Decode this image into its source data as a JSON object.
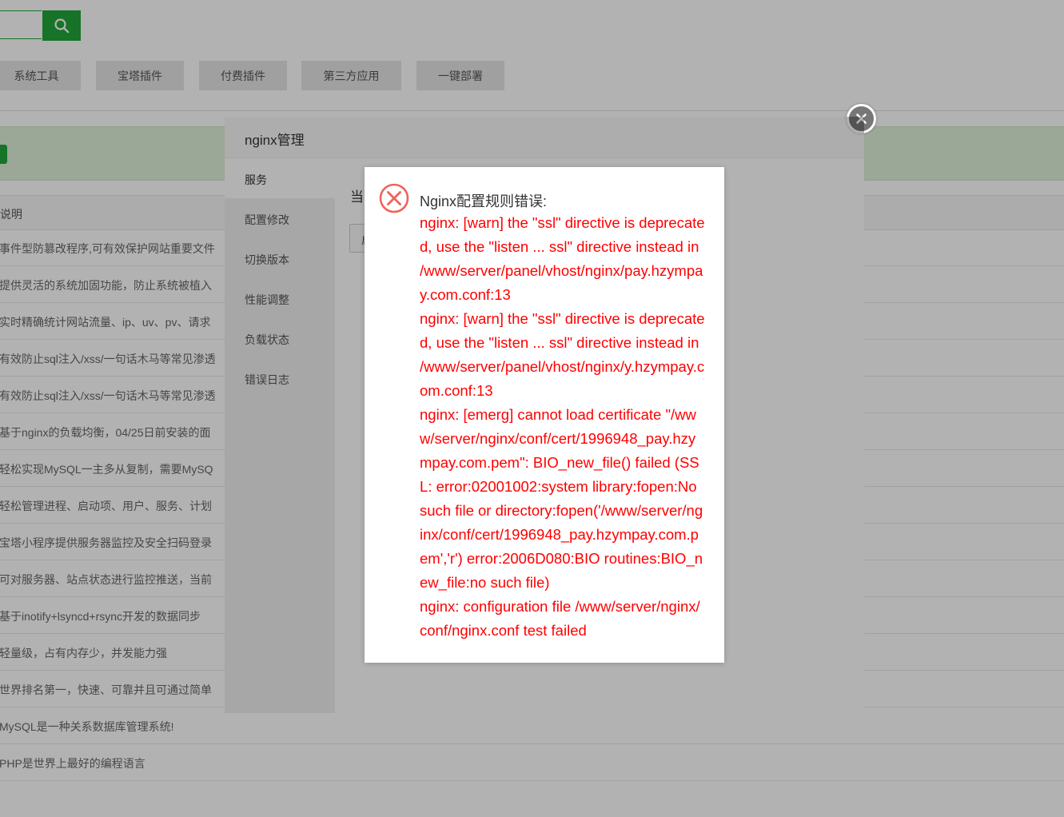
{
  "tabs": [
    "系统工具",
    "宝塔插件",
    "付费插件",
    "第三方应用",
    "一键部署"
  ],
  "table": {
    "header": "说明",
    "rows": [
      "事件型防篡改程序,可有效保护网站重要文件",
      "提供灵活的系统加固功能，防止系统被植入",
      "实时精确统计网站流量、ip、uv、pv、请求",
      "有效防止sql注入/xss/一句话木马等常见渗透",
      "有效防止sql注入/xss/一句话木马等常见渗透",
      "基于nginx的负载均衡，04/25日前安装的面",
      "轻松实现MySQL一主多从复制，需要MySQ",
      "轻松管理进程、启动项、用户、服务、计划",
      "宝塔小程序提供服务器监控及安全扫码登录",
      "可对服务器、站点状态进行监控推送，当前",
      "基于inotify+lsyncd+rsync开发的数据同步",
      "轻量级，占有内存少，并发能力强",
      "世界排名第一，快速、可靠并且可通过简单",
      "MySQL是一种关系数据库管理系统!",
      "PHP是世界上最好的编程语言"
    ]
  },
  "modal": {
    "title": "nginx管理",
    "menu": [
      "服务",
      "配置修改",
      "切换版本",
      "性能调整",
      "负载状态",
      "错误日志"
    ],
    "body_label": "当",
    "body_button": "启"
  },
  "error": {
    "title": "Nginx配置规则错误:",
    "lines": [
      "nginx: [warn] the \"ssl\" directive is deprecated, use the \"listen ... ssl\" directive instead in /www/server/panel/vhost/nginx/pay.hzympay.com.conf:13",
      "nginx: [warn] the \"ssl\" directive is deprecated, use the \"listen ... ssl\" directive instead in /www/server/panel/vhost/nginx/y.hzympay.com.conf:13",
      "nginx: [emerg] cannot load certificate \"/www/server/nginx/conf/cert/1996948_pay.hzympay.com.pem\": BIO_new_file() failed (SSL: error:02001002:system library:fopen:No such file or directory:fopen('/www/server/nginx/conf/cert/1996948_pay.hzympay.com.pem','r') error:2006D080:BIO routines:BIO_new_file:no such file)",
      "nginx: configuration file /www/server/nginx/conf/nginx.conf test failed"
    ]
  }
}
